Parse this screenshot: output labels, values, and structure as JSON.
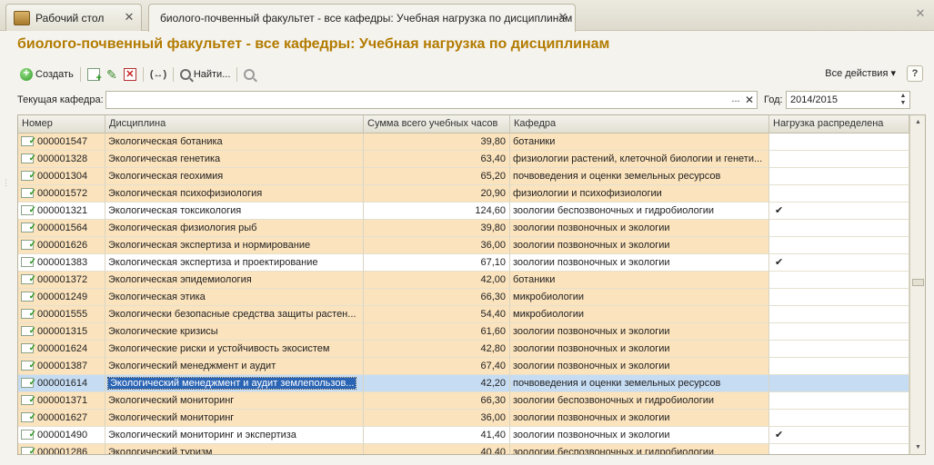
{
  "tabs": [
    {
      "label": "Рабочий стол",
      "close": "✕"
    },
    {
      "label": "биолого-почвенный факультет - все кафедры: Учебная нагрузка по дисциплинам",
      "close": "✕"
    }
  ],
  "window_close": "✕",
  "page_title": "биолого-почвенный факультет - все кафедры: Учебная нагрузка по дисциплинам",
  "toolbar": {
    "create_label": "Создать",
    "find_label": "Найти...",
    "all_actions_label": "Все действия ▾",
    "help_label": "?"
  },
  "filters": {
    "dept_label": "Текущая кафедра:",
    "dept_value": "",
    "dept_select": "...",
    "dept_clear": "✕",
    "year_label": "Год:",
    "year_value": "2014/2015"
  },
  "table": {
    "columns": [
      "Номер",
      "Дисциплина",
      "Сумма всего учебных часов",
      "Кафедра",
      "Нагрузка распределена"
    ],
    "rows": [
      {
        "num": "000001547",
        "disc": "Экологическая ботаника",
        "sum": "39,80",
        "dept": "ботаники",
        "load": "",
        "style": "orange"
      },
      {
        "num": "000001328",
        "disc": "Экологическая генетика",
        "sum": "63,40",
        "dept": "физиологии растений, клеточной биологии и генети...",
        "load": "",
        "style": "orange"
      },
      {
        "num": "000001304",
        "disc": "Экологическая геохимия",
        "sum": "65,20",
        "dept": "почвоведения и оценки земельных ресурсов",
        "load": "",
        "style": "orange"
      },
      {
        "num": "000001572",
        "disc": "Экологическая психофизиология",
        "sum": "20,90",
        "dept": "физиологии и психофизиологии",
        "load": "",
        "style": "orange"
      },
      {
        "num": "000001321",
        "disc": "Экологическая токсикология",
        "sum": "124,60",
        "dept": "зоологии беспозвоночных и гидробиологии",
        "load": "✔",
        "style": "white"
      },
      {
        "num": "000001564",
        "disc": "Экологическая физиология рыб",
        "sum": "39,80",
        "dept": "зоологии позвоночных и экологии",
        "load": "",
        "style": "orange"
      },
      {
        "num": "000001626",
        "disc": "Экологическая экспертиза и нормирование",
        "sum": "36,00",
        "dept": "зоологии позвоночных и экологии",
        "load": "",
        "style": "orange"
      },
      {
        "num": "000001383",
        "disc": "Экологическая экспертиза и проектирование",
        "sum": "67,10",
        "dept": "зоологии позвоночных и экологии",
        "load": "✔",
        "style": "white"
      },
      {
        "num": "000001372",
        "disc": "Экологическая эпидемиология",
        "sum": "42,00",
        "dept": "ботаники",
        "load": "",
        "style": "orange"
      },
      {
        "num": "000001249",
        "disc": "Экологическая этика",
        "sum": "66,30",
        "dept": "микробиологии",
        "load": "",
        "style": "orange"
      },
      {
        "num": "000001555",
        "disc": "Экологически безопасные средства защиты растен...",
        "sum": "54,40",
        "dept": "микробиологии",
        "load": "",
        "style": "orange"
      },
      {
        "num": "000001315",
        "disc": "Экологические кризисы",
        "sum": "61,60",
        "dept": "зоологии позвоночных и экологии",
        "load": "",
        "style": "orange"
      },
      {
        "num": "000001624",
        "disc": "Экологические риски и устойчивость экосистем",
        "sum": "42,80",
        "dept": "зоологии позвоночных и экологии",
        "load": "",
        "style": "orange"
      },
      {
        "num": "000001387",
        "disc": "Экологический менеджмент и аудит",
        "sum": "67,40",
        "dept": "зоологии позвоночных и экологии",
        "load": "",
        "style": "orange"
      },
      {
        "num": "000001614",
        "disc": "Экологический менеджмент и аудит землепользов...",
        "sum": "42,20",
        "dept": "почвоведения и оценки земельных ресурсов",
        "load": "",
        "style": "sel"
      },
      {
        "num": "000001371",
        "disc": "Экологический мониторинг",
        "sum": "66,30",
        "dept": "зоологии беспозвоночных и гидробиологии",
        "load": "",
        "style": "orange"
      },
      {
        "num": "000001627",
        "disc": "Экологический мониторинг",
        "sum": "36,00",
        "dept": "зоологии позвоночных и экологии",
        "load": "",
        "style": "orange"
      },
      {
        "num": "000001490",
        "disc": "Экологический мониторинг и экспертиза",
        "sum": "41,40",
        "dept": "зоологии позвоночных и экологии",
        "load": "✔",
        "style": "white"
      },
      {
        "num": "000001286",
        "disc": "Экологический туризм",
        "sum": "40,40",
        "dept": "зоологии беспозвоночных и гидробиологии",
        "load": "",
        "style": "orange"
      }
    ]
  },
  "colors": {
    "title": "#b37b00",
    "row_orange": "#fbe3bd",
    "row_selected": "#c6dcf3"
  }
}
